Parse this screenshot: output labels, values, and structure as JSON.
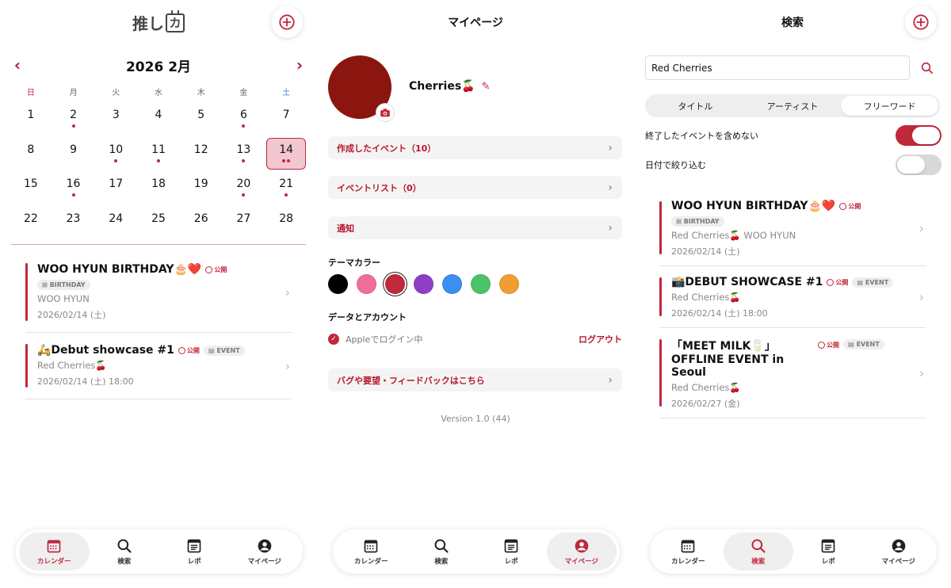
{
  "calendar": {
    "logo_text": "推し",
    "logo_box": "カ",
    "prev": "‹",
    "next": "›",
    "month_label": "2026 2月",
    "weekdays": [
      "日",
      "月",
      "火",
      "水",
      "木",
      "金",
      "土"
    ],
    "days": [
      "1",
      "2",
      "3",
      "4",
      "5",
      "6",
      "7",
      "8",
      "9",
      "10",
      "11",
      "12",
      "13",
      "14",
      "15",
      "16",
      "17",
      "18",
      "19",
      "20",
      "21",
      "22",
      "23",
      "24",
      "25",
      "26",
      "27",
      "28"
    ],
    "events": [
      {
        "title": "WOO HYUN BIRTHDAY🎂❤️",
        "public": "公開",
        "type": "BIRTHDAY",
        "sub": "WOO HYUN",
        "date": "2026/02/14 (土)"
      },
      {
        "title": "🛵Debut showcase #1",
        "public": "公開",
        "type": "EVENT",
        "sub": "Red Cherries🍒",
        "date": "2026/02/14 (土) 18:00"
      }
    ]
  },
  "mypage": {
    "title": "マイページ",
    "name": "Cherries🍒",
    "menu": [
      "作成したイベント（10）",
      "イベントリスト（0）",
      "通知"
    ],
    "theme_label": "テーマカラー",
    "theme_colors": [
      "#000000",
      "#ee7098",
      "#c0283c",
      "#8e3fc8",
      "#3b8ff0",
      "#4cc366",
      "#f29c35"
    ],
    "selected_color": "#c0283c",
    "account_label": "データとアカウント",
    "apple_login": "Appleでログイン中",
    "logout": "ログアウト",
    "feedback": "バグや要望・フィードバックはこちら",
    "version": "Version 1.0 (44)"
  },
  "search": {
    "title": "検索",
    "query": "Red Cherries",
    "segments": [
      "タイトル",
      "アーティスト",
      "フリーワード"
    ],
    "active_segment": "フリーワード",
    "toggle1_label": "終了したイベントを含めない",
    "toggle1_on": true,
    "toggle2_label": "日付で絞り込む",
    "toggle2_on": false,
    "results": [
      {
        "title": "WOO HYUN BIRTHDAY🎂❤️",
        "public": "公開",
        "type": "BIRTHDAY",
        "sub": "Red Cherries🍒 WOO HYUN",
        "date": "2026/02/14 (土)"
      },
      {
        "title": "📸DEBUT SHOWCASE #1",
        "public": "公開",
        "type": "EVENT",
        "sub": "Red Cherries🍒",
        "date": "2026/02/14 (土) 18:00"
      },
      {
        "title": "「MEET MILK🥛」OFFLINE EVENT in Seoul",
        "public": "公開",
        "type": "EVENT",
        "sub": "Red Cherries🍒",
        "date": "2026/02/27 (金)"
      }
    ]
  },
  "tabs": [
    "カレンダー",
    "検索",
    "レポ",
    "マイページ"
  ],
  "accent_color": "#c0283c"
}
